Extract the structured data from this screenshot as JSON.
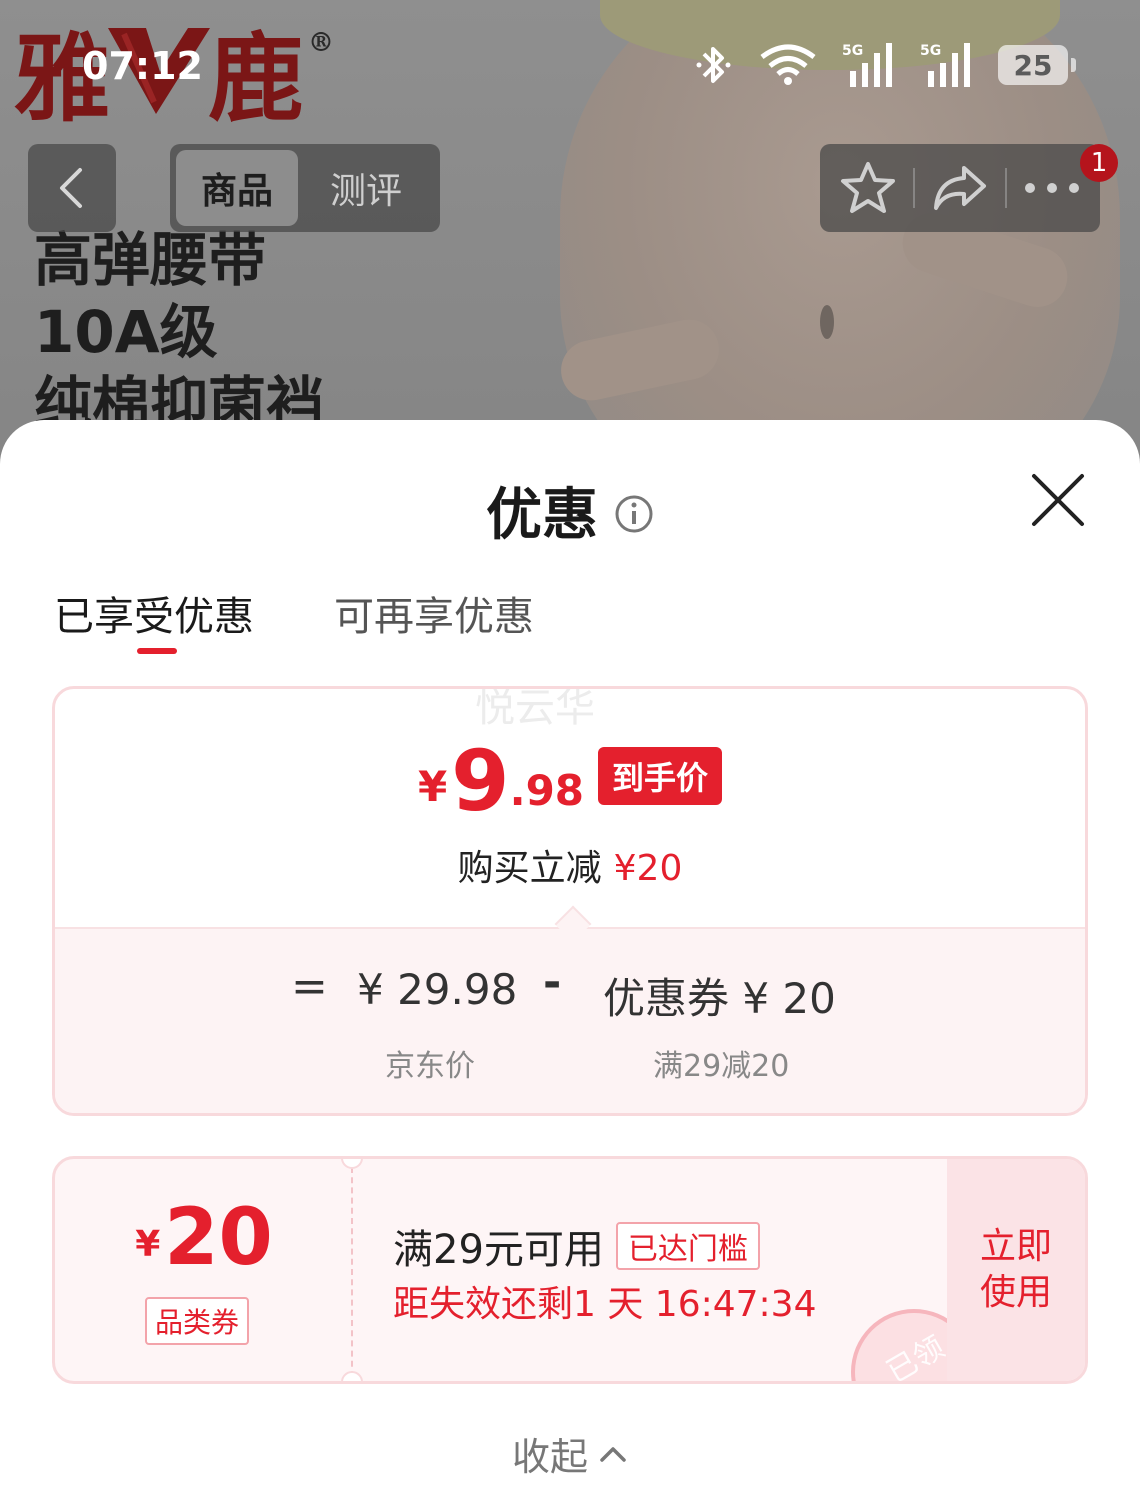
{
  "status_bar": {
    "time": "07:12",
    "signal_1": "5G",
    "signal_2": "5G",
    "battery": "25"
  },
  "hero": {
    "brand_left": "雅",
    "brand_right": "鹿",
    "brand_mark": "®",
    "lines": [
      "高弹腰带",
      "10A级",
      "纯棉抑菌裆"
    ]
  },
  "nav": {
    "tabs": [
      "商品",
      "测评"
    ],
    "badge": "1"
  },
  "sheet": {
    "title": "优惠",
    "tabs": [
      "已享受优惠",
      "可再享优惠"
    ],
    "watermark": "悦云华",
    "price_card": {
      "currency": "¥",
      "final_int": "9",
      "final_dec": ".98",
      "final_tag": "到手价",
      "instant_label": "购买立减",
      "instant_amount": "¥20",
      "eq": "=",
      "base_price": "¥ 29.98",
      "base_label": "京东价",
      "minus": "-",
      "coupon_text": "优惠券 ¥ 20",
      "coupon_label": "满29减20"
    },
    "coupon": {
      "currency": "¥",
      "amount": "20",
      "type": "品类券",
      "condition": "满29元可用",
      "reached": "已达门槛",
      "expire": "距失效还剩1 天 16:47:34",
      "action": "立即使用",
      "stamp": "已领"
    },
    "collapse": "收起"
  },
  "colors": {
    "accent": "#e4202d",
    "card_border": "#f8d9dc",
    "card_bg": "#fdf3f4"
  }
}
